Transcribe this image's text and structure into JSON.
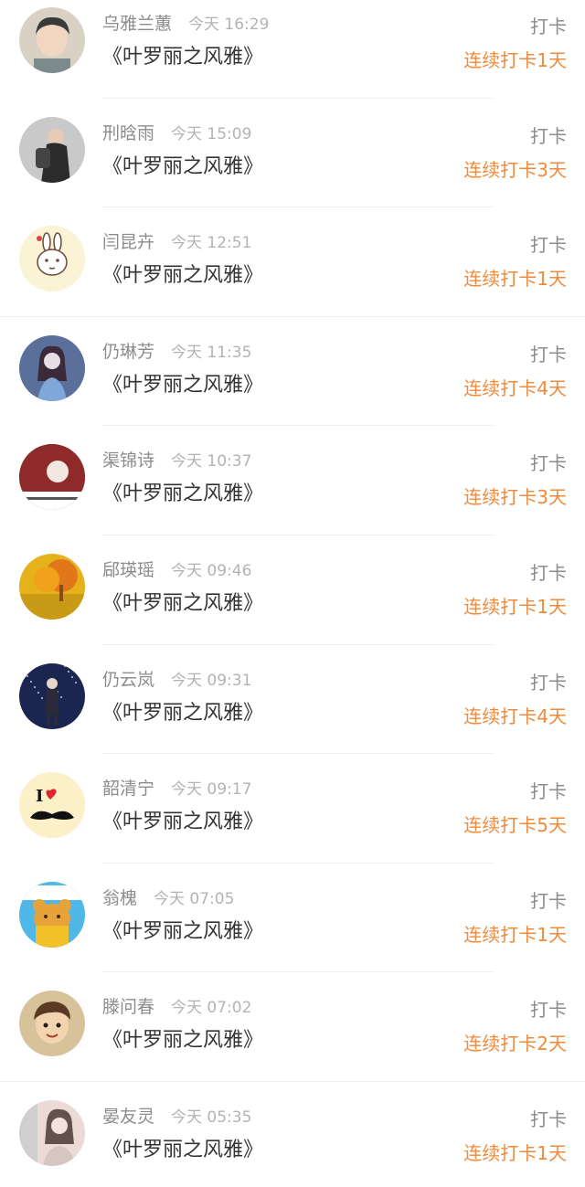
{
  "entries": [
    {
      "username": "乌雅兰蕙",
      "time": "今天 16:29",
      "book": "《叶罗丽之风雅》",
      "action": "打卡",
      "streak": "连续打卡1天",
      "avatar": {
        "icon": "boy-portrait-avatar",
        "bg": "#d9d2c4",
        "fg": "#3a3a3a"
      }
    },
    {
      "username": "刑晗雨",
      "time": "今天 15:09",
      "book": "《叶罗丽之风雅》",
      "action": "打卡",
      "streak": "连续打卡3天",
      "avatar": {
        "icon": "girl-backpack-avatar",
        "bg": "#c9c9c9",
        "fg": "#2b2b2b"
      }
    },
    {
      "username": "闫昆卉",
      "time": "今天 12:51",
      "book": "《叶罗丽之风雅》",
      "action": "打卡",
      "streak": "连续打卡1天",
      "avatar": {
        "icon": "cartoon-rabbit-avatar",
        "bg": "#fbf3d6",
        "fg": "#6b4a3a"
      }
    },
    {
      "username": "仍琳芳",
      "time": "今天 11:35",
      "book": "《叶罗丽之风雅》",
      "action": "打卡",
      "streak": "连续打卡4天",
      "avatar": {
        "icon": "anime-girl-avatar",
        "bg": "#5a6f9a",
        "fg": "#e8dfe6"
      }
    },
    {
      "username": "渠锦诗",
      "time": "今天 10:37",
      "book": "《叶罗丽之风雅》",
      "action": "打卡",
      "streak": "连续打卡3天",
      "avatar": {
        "icon": "red-hair-girl-avatar",
        "bg": "#8e2a2a",
        "fg": "#f4e6e0"
      }
    },
    {
      "username": "郈瑛瑶",
      "time": "今天 09:46",
      "book": "《叶罗丽之风雅》",
      "action": "打卡",
      "streak": "连续打卡1天",
      "avatar": {
        "icon": "autumn-tree-avatar",
        "bg": "#e6b21c",
        "fg": "#8a4b12"
      }
    },
    {
      "username": "仍云岚",
      "time": "今天 09:31",
      "book": "《叶罗丽之风雅》",
      "action": "打卡",
      "streak": "连续打卡4天",
      "avatar": {
        "icon": "night-sky-figure-avatar",
        "bg": "#1a2550",
        "fg": "#c7cff0"
      }
    },
    {
      "username": "韶清宁",
      "time": "今天 09:17",
      "book": "《叶罗丽之风雅》",
      "action": "打卡",
      "streak": "连续打卡5天",
      "avatar": {
        "icon": "i-love-mustache-avatar",
        "bg": "#fbf0c8",
        "fg": "#111111"
      }
    },
    {
      "username": "翁槐",
      "time": "今天 07:05",
      "book": "《叶罗丽之风雅》",
      "action": "打卡",
      "streak": "连续打卡1天",
      "avatar": {
        "icon": "cartoon-bear-avatar",
        "bg": "#4fb8e8",
        "fg": "#e8a23a"
      }
    },
    {
      "username": "滕问春",
      "time": "今天 07:02",
      "book": "《叶罗丽之风雅》",
      "action": "打卡",
      "streak": "连续打卡2天",
      "avatar": {
        "icon": "cartoon-boy-avatar",
        "bg": "#d8c29a",
        "fg": "#5a3a22"
      }
    },
    {
      "username": "晏友灵",
      "time": "今天 05:35",
      "book": "《叶罗丽之风雅》",
      "action": "打卡",
      "streak": "连续打卡1天",
      "avatar": {
        "icon": "girl-photo-avatar",
        "bg": "#ecdad6",
        "fg": "#4a3a36"
      }
    }
  ]
}
